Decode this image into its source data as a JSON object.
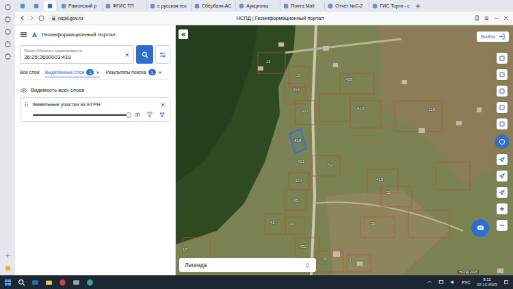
{
  "browser": {
    "pinned": [
      {
        "selected": false
      },
      {
        "selected": false
      },
      {
        "selected": true
      }
    ],
    "tabs": [
      {
        "label": "Рамонский р",
        "selected": false
      },
      {
        "label": "ФГИС ТП",
        "selected": false
      },
      {
        "label": "с русская гео",
        "selected": false
      },
      {
        "label": "Сбербанк-АС",
        "selected": false
      },
      {
        "label": "Аукционы",
        "selected": false
      },
      {
        "label": "Почта Mail",
        "selected": false
      },
      {
        "label": "Отчет №С-2",
        "selected": false
      },
      {
        "label": "ГИС Торги - с",
        "selected": false
      }
    ],
    "address": "nspd.gov.ru",
    "page_title": "НСПД | Геоинформационный портал"
  },
  "portal": {
    "title": "Геоинформационный портал",
    "search": {
      "label": "Поиск Объекты недвижимости",
      "value": "36:25:2600003:419"
    },
    "panel_tabs": [
      {
        "label": "Все слои",
        "selected": false
      },
      {
        "label": "Выделенные слои",
        "count": "1",
        "selected": true
      },
      {
        "label": "Результаты поиска",
        "count": "1",
        "selected": false
      }
    ],
    "visibility_label": "Видимость всех слоев",
    "layers": [
      {
        "name": "Земельные участки из ЕГРН",
        "visible": true,
        "level": 1
      }
    ]
  },
  "map": {
    "login": "Войти",
    "legend": "Легенда",
    "attribution": "НСПД 2025",
    "parcels": [
      {
        "label": "13",
        "selected": false
      },
      {
        "label": "15",
        "selected": false
      },
      {
        "label": "416",
        "selected": false
      },
      {
        "label": "408",
        "selected": false
      },
      {
        "label": "417",
        "selected": false
      },
      {
        "label": "413",
        "selected": false
      },
      {
        "label": "115",
        "selected": false
      },
      {
        "label": "419",
        "selected": true
      },
      {
        "label": "421",
        "selected": false
      },
      {
        "label": "52",
        "selected": false
      },
      {
        "label": "418",
        "selected": false
      },
      {
        "label": "420",
        "selected": false
      },
      {
        "label": "51",
        "selected": false
      },
      {
        "label": "43",
        "selected": false
      },
      {
        "label": "41",
        "selected": false
      },
      {
        "label": "40",
        "selected": false
      },
      {
        "label": "55",
        "selected": false
      },
      {
        "label": "432",
        "selected": false
      },
      {
        "label": "17",
        "selected": false
      },
      {
        "label": "19",
        "selected": false
      },
      {
        "label": "17",
        "selected": false
      }
    ]
  },
  "taskbar": {
    "language": "РУС",
    "time": "9:11",
    "date": "22.12.2025"
  }
}
